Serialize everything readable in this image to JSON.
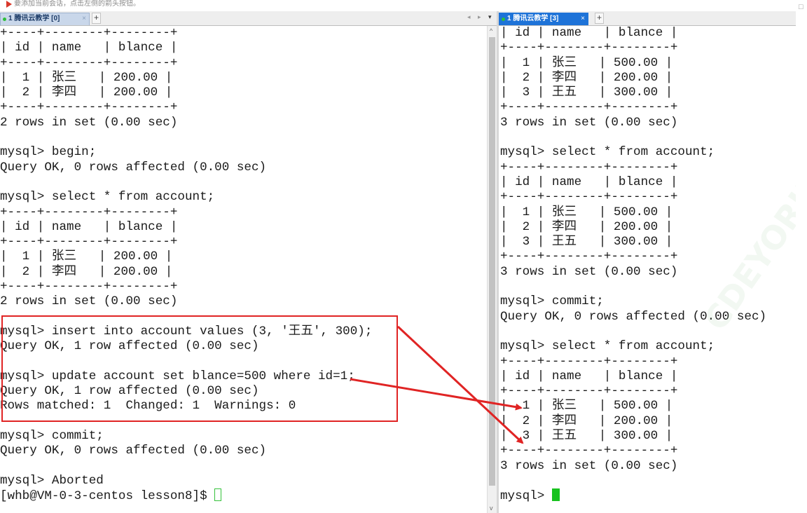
{
  "hint_text": "要添加当前会话，点击左侧的箭头按钮。",
  "left_pane": {
    "tab_label": "1 腾讯云教学 [0]",
    "tab_close": "×",
    "add_tab": "+",
    "nav_arrows": "◂ ▸",
    "dropdown": "▾",
    "lines": [
      "+----+--------+--------+",
      "| id | name   | blance |",
      "+----+--------+--------+",
      "|  1 | 张三   | 200.00 |",
      "|  2 | 李四   | 200.00 |",
      "+----+--------+--------+",
      "2 rows in set (0.00 sec)",
      "",
      "mysql> begin;",
      "Query OK, 0 rows affected (0.00 sec)",
      "",
      "mysql> select * from account;",
      "+----+--------+--------+",
      "| id | name   | blance |",
      "+----+--------+--------+",
      "|  1 | 张三   | 200.00 |",
      "|  2 | 李四   | 200.00 |",
      "+----+--------+--------+",
      "2 rows in set (0.00 sec)",
      "",
      "mysql> insert into account values (3, '王五', 300);",
      "Query OK, 1 row affected (0.00 sec)",
      "",
      "mysql> update account set blance=500 where id=1;",
      "Query OK, 1 row affected (0.00 sec)",
      "Rows matched: 1  Changed: 1  Warnings: 0",
      "",
      "mysql> commit;",
      "Query OK, 0 rows affected (0.00 sec)",
      "",
      "mysql> Aborted"
    ],
    "prompt_line": "[whb@VM-0-3-centos lesson8]$ "
  },
  "right_pane": {
    "tab_label": "1 腾讯云教学 [3]",
    "tab_close": "×",
    "add_tab": "+",
    "lines": [
      "| id | name   | blance |",
      "+----+--------+--------+",
      "|  1 | 张三   | 500.00 |",
      "|  2 | 李四   | 200.00 |",
      "|  3 | 王五   | 300.00 |",
      "+----+--------+--------+",
      "3 rows in set (0.00 sec)",
      "",
      "mysql> select * from account;",
      "+----+--------+--------+",
      "| id | name   | blance |",
      "+----+--------+--------+",
      "|  1 | 张三   | 500.00 |",
      "|  2 | 李四   | 200.00 |",
      "|  3 | 王五   | 300.00 |",
      "+----+--------+--------+",
      "3 rows in set (0.00 sec)",
      "",
      "mysql> commit;",
      "Query OK, 0 rows affected (0.00 sec)",
      "",
      "mysql> select * from account;",
      "+----+--------+--------+",
      "| id | name   | blance |",
      "+----+--------+--------+",
      "|  1 | 张三   | 500.00 |",
      "|  2 | 李四   | 200.00 |",
      "|  3 | 王五   | 300.00 |",
      "+----+--------+--------+",
      "3 rows in set (0.00 sec)",
      ""
    ],
    "prompt_line": "mysql> "
  },
  "scroll_up": "^",
  "scroll_down": "v",
  "watermark": "CDEYORLY",
  "right_edge_glyph": "□",
  "colors": {
    "tab_active": "#1e73d8",
    "annotation_red": "#e02424",
    "cursor_green": "#18c21f"
  }
}
